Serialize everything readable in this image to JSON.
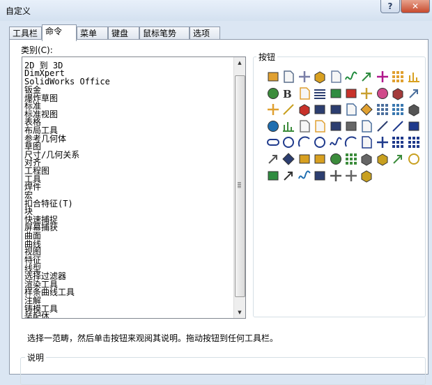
{
  "window": {
    "title": "自定义",
    "help_label": "?",
    "close_label": "✕"
  },
  "tabs": [
    {
      "label": "工具栏",
      "active": false
    },
    {
      "label": "命令",
      "active": true
    },
    {
      "label": "菜单",
      "active": false
    },
    {
      "label": "键盘",
      "active": false
    },
    {
      "label": "鼠标笔势",
      "active": false
    },
    {
      "label": "选项",
      "active": false
    }
  ],
  "categories": {
    "label": "类别(C):",
    "items": [
      "2D 到 3D",
      "DimXpert",
      "SolidWorks Office",
      "钣金",
      "爆炸草图",
      "标准",
      "标准视图",
      "表格",
      "布局工具",
      "参考几何体",
      "草图",
      "尺寸/几何关系",
      "对齐",
      "工程图",
      "工具",
      "焊件",
      "宏",
      "扣合特征(T)",
      "块",
      "快速捕捉",
      "屏幕捕获",
      "曲面",
      "曲线",
      "视图",
      "特征",
      "线型",
      "选择过滤器",
      "渲染工具",
      "样条曲线工具",
      "注解",
      "铸模工具",
      "装配体"
    ]
  },
  "buttons": {
    "label": "按钮",
    "icons": [
      {
        "name": "sketch-block-icon",
        "color": "#e0a030",
        "glyph": "rect"
      },
      {
        "name": "note-balloon-icon",
        "color": "#5a6e8c",
        "glyph": "page"
      },
      {
        "name": "text-annotation-icon",
        "color": "#7a7fa8",
        "glyph": "cross"
      },
      {
        "name": "material-icon",
        "color": "#d8a020",
        "glyph": "cube"
      },
      {
        "name": "measure-icon",
        "color": "#6a7fa0",
        "glyph": "page"
      },
      {
        "name": "spline-icon",
        "color": "#1f8a3c",
        "glyph": "wave"
      },
      {
        "name": "mate-icon",
        "color": "#2f8c40",
        "glyph": "arrow"
      },
      {
        "name": "crosshair-icon",
        "color": "#b0178c",
        "glyph": "cross"
      },
      {
        "name": "grid-display-icon",
        "color": "#e0a030",
        "glyph": "grid"
      },
      {
        "name": "dimension-icon",
        "color": "#d8a020",
        "glyph": "line"
      },
      {
        "name": "globe-display-icon",
        "color": "#3c8c3c",
        "glyph": "ball"
      },
      {
        "name": "bold-text-icon",
        "color": "#333333",
        "glyph": "bold"
      },
      {
        "name": "folder-icon",
        "color": "#e0a030",
        "glyph": "page"
      },
      {
        "name": "list-icon",
        "color": "#2c3e70",
        "glyph": "lines"
      },
      {
        "name": "model-icon",
        "color": "#2f8c40",
        "glyph": "rect"
      },
      {
        "name": "section-view-icon",
        "color": "#c8322a",
        "glyph": "rect"
      },
      {
        "name": "smart-tool-icon",
        "color": "#c9a030",
        "glyph": "cross"
      },
      {
        "name": "color-wheel-icon",
        "color": "#d04a8a",
        "glyph": "ball"
      },
      {
        "name": "printer-icon",
        "color": "#a33a3a",
        "glyph": "cube"
      },
      {
        "name": "select-arrow-icon",
        "color": "#4a6e9c",
        "glyph": "arrow"
      },
      {
        "name": "move-component-icon",
        "color": "#e0a030",
        "glyph": "cross"
      },
      {
        "name": "percent-icon",
        "color": "#c8a020",
        "glyph": "slash"
      },
      {
        "name": "cube-red-icon",
        "color": "#c8322a",
        "glyph": "cube"
      },
      {
        "name": "library-icon",
        "color": "#2c3e70",
        "glyph": "rect"
      },
      {
        "name": "save-icon",
        "color": "#2c3e70",
        "glyph": "rect"
      },
      {
        "name": "copy-icon",
        "color": "#4a6e9c",
        "glyph": "page"
      },
      {
        "name": "edit-tag-icon",
        "color": "#e0a030",
        "glyph": "diamond"
      },
      {
        "name": "table-icon",
        "color": "#4a6e9c",
        "glyph": "grid"
      },
      {
        "name": "hole-table-icon",
        "color": "#3a78b0",
        "glyph": "grid"
      },
      {
        "name": "box-view-icon",
        "color": "#555555",
        "glyph": "cube"
      },
      {
        "name": "earth-icon",
        "color": "#1f6eb0",
        "glyph": "ball"
      },
      {
        "name": "chart-icon",
        "color": "#3c8c3c",
        "glyph": "line"
      },
      {
        "name": "new-doc-icon",
        "color": "#777777",
        "glyph": "page"
      },
      {
        "name": "open-folder-icon",
        "color": "#e0a030",
        "glyph": "page"
      },
      {
        "name": "floppy-icon",
        "color": "#2c3e70",
        "glyph": "rect"
      },
      {
        "name": "print-icon",
        "color": "#666666",
        "glyph": "rect"
      },
      {
        "name": "sheet-icon",
        "color": "#4a6e9c",
        "glyph": "page"
      },
      {
        "name": "edit-sketch-icon",
        "color": "#2c3e70",
        "glyph": "slash"
      },
      {
        "name": "line-icon",
        "color": "#1f3a8c",
        "glyph": "slash"
      },
      {
        "name": "rectangle-icon",
        "color": "#1f3a8c",
        "glyph": "rect"
      },
      {
        "name": "slot-icon",
        "color": "#1f3a8c",
        "glyph": "slot"
      },
      {
        "name": "circle-icon",
        "color": "#1f3a8c",
        "glyph": "circle"
      },
      {
        "name": "arc-icon",
        "color": "#1f3a8c",
        "glyph": "arc"
      },
      {
        "name": "ellipse-icon",
        "color": "#1f3a8c",
        "glyph": "circle"
      },
      {
        "name": "spline-curve-icon",
        "color": "#1f3a8c",
        "glyph": "wave"
      },
      {
        "name": "fillet-icon",
        "color": "#1f3a8c",
        "glyph": "arc"
      },
      {
        "name": "offset-icon",
        "color": "#1f3a8c",
        "glyph": "page"
      },
      {
        "name": "trim-icon",
        "color": "#1f3a8c",
        "glyph": "cross"
      },
      {
        "name": "point-icon",
        "color": "#1f3a8c",
        "glyph": "grid"
      },
      {
        "name": "pattern-icon",
        "color": "#1f3a8c",
        "glyph": "grid"
      },
      {
        "name": "mirror-icon",
        "color": "#555555",
        "glyph": "arrow"
      },
      {
        "name": "tag-icon",
        "color": "#2c3e70",
        "glyph": "diamond"
      },
      {
        "name": "layer-icon",
        "color": "#d8a020",
        "glyph": "rect"
      },
      {
        "name": "feature-icon",
        "color": "#d8a020",
        "glyph": "rect"
      },
      {
        "name": "extrude-icon",
        "color": "#3c8c3c",
        "glyph": "ball"
      },
      {
        "name": "linear-pattern-icon",
        "color": "#3c8c3c",
        "glyph": "grid"
      },
      {
        "name": "shell-icon",
        "color": "#666666",
        "glyph": "cube"
      },
      {
        "name": "assembly-icon",
        "color": "#c8a020",
        "glyph": "cube"
      },
      {
        "name": "explode-icon",
        "color": "#3c8c3c",
        "glyph": "arrow"
      },
      {
        "name": "rotate-icon",
        "color": "#c8a020",
        "glyph": "circle"
      },
      {
        "name": "weldment-icon",
        "color": "#2f8c40",
        "glyph": "rect"
      },
      {
        "name": "reverse-icon",
        "color": "#333333",
        "glyph": "arrow"
      },
      {
        "name": "zigzag-icon",
        "color": "#1f6eb0",
        "glyph": "wave"
      },
      {
        "name": "display-icon",
        "color": "#2c3e70",
        "glyph": "rect"
      },
      {
        "name": "tool-icon",
        "color": "#555555",
        "glyph": "cross"
      },
      {
        "name": "magnet-icon",
        "color": "#666666",
        "glyph": "cross"
      },
      {
        "name": "mold-icon",
        "color": "#c8a020",
        "glyph": "cube"
      }
    ]
  },
  "instruction": "选择一范畴，然后单击按钮来观阅其说明。拖动按钮到任何工具栏。",
  "description": {
    "label": "说明"
  }
}
